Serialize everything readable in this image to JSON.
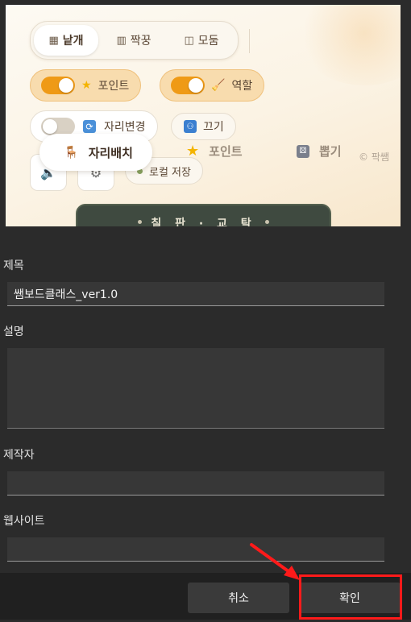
{
  "preview": {
    "layout_modes": [
      {
        "icon": "grid-icon",
        "label": "낱개",
        "active": true
      },
      {
        "icon": "pair-icon",
        "label": "짝꿍",
        "active": false
      },
      {
        "icon": "group-icon",
        "label": "모둠",
        "active": false
      }
    ],
    "point_toggle": {
      "label": "포인트",
      "on": true
    },
    "role_toggle": {
      "label": "역할",
      "on": true
    },
    "seat_change_toggle": {
      "label": "자리변경",
      "on": false
    },
    "turn_off_label": "끄기",
    "local_save_label": "로컬 저장",
    "tabs": {
      "seat": "자리배치",
      "point": "포인트",
      "draw": "뽑기"
    },
    "copyright": "© 팍쌤",
    "board_label": "칠 판 · 교 탁"
  },
  "form": {
    "title_label": "제목",
    "title_value": "쌤보드클래스_ver1.0",
    "description_label": "설명",
    "description_value": "",
    "author_label": "제작자",
    "author_value": "",
    "website_label": "웹사이트",
    "website_value": ""
  },
  "buttons": {
    "cancel": "취소",
    "ok": "확인"
  },
  "colors": {
    "accent_orange": "#ef9a16",
    "highlight_red": "#ff1a1a",
    "dialog_bg": "#2b2b2b"
  }
}
